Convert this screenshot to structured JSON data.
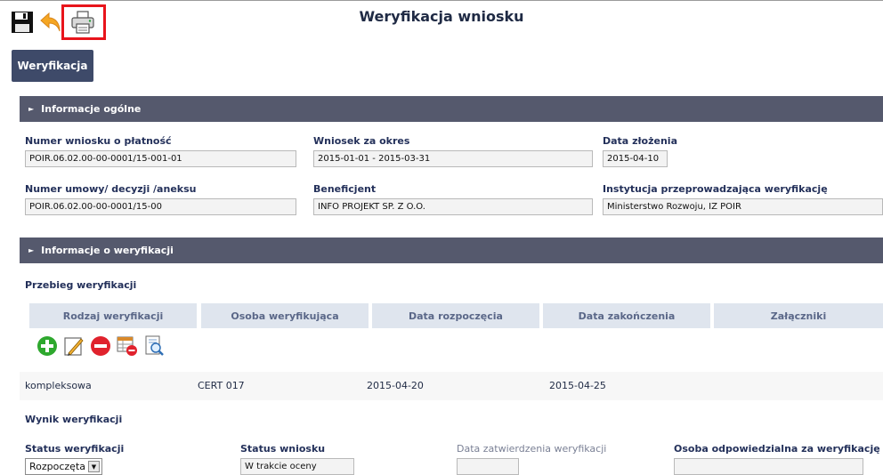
{
  "page": {
    "title": "Weryfikacja wniosku"
  },
  "toolbar": {
    "icons": [
      "save-icon",
      "undo-icon",
      "print-icon"
    ],
    "highlight_color": "#e8141b"
  },
  "tabs": {
    "active_label": "Weryfikacja"
  },
  "sections": {
    "general": {
      "header": "Informacje ogólne",
      "fields": {
        "payment_app_number": {
          "label": "Numer wniosku o płatność",
          "value": "POIR.06.02.00-00-0001/15-001-01"
        },
        "period": {
          "label": "Wniosek za okres",
          "value": "2015-01-01 - 2015-03-31"
        },
        "submission_date": {
          "label": "Data złożenia",
          "value": "2015-04-10"
        },
        "contract_number": {
          "label": "Numer umowy/ decyzji /aneksu",
          "value": "POIR.06.02.00-00-0001/15-00"
        },
        "beneficiary": {
          "label": "Beneficjent",
          "value": "INFO PROJEKT SP. Z O.O."
        },
        "institution": {
          "label": "Instytucja przeprowadzająca weryfikację",
          "value": "Ministerstwo Rozwoju, IZ POIR"
        }
      }
    },
    "verification": {
      "header": "Informacje o weryfikacji",
      "progress_title": "Przebieg weryfikacji",
      "columns": [
        "Rodzaj weryfikacji",
        "Osoba weryfikująca",
        "Data rozpoczęcia",
        "Data zakończenia",
        "Załączniki"
      ],
      "action_icons": [
        "add-icon",
        "edit-icon",
        "remove-icon",
        "table-delete-icon",
        "preview-icon"
      ],
      "rows": [
        {
          "type": "kompleksowa",
          "person": "CERT 017",
          "start": "2015-04-20",
          "end": "2015-04-25",
          "attachments": ""
        }
      ],
      "result_title": "Wynik weryfikacji",
      "result": {
        "status_label": "Status weryfikacji",
        "status_value": "Rozpoczęta",
        "app_status_label": "Status wniosku",
        "app_status_value": "W trakcie oceny",
        "approval_date_label": "Data zatwierdzenia weryfikacji",
        "approval_date_value": "",
        "responsible_label": "Osoba odpowiedzialna za weryfikację",
        "responsible_value": ""
      }
    }
  },
  "colors": {
    "header_bg": "#55596d",
    "tab_bg": "#3e4a69",
    "table_head_bg": "#dfe5ee",
    "add_green": "#2ea82e",
    "remove_red": "#e0222d"
  }
}
